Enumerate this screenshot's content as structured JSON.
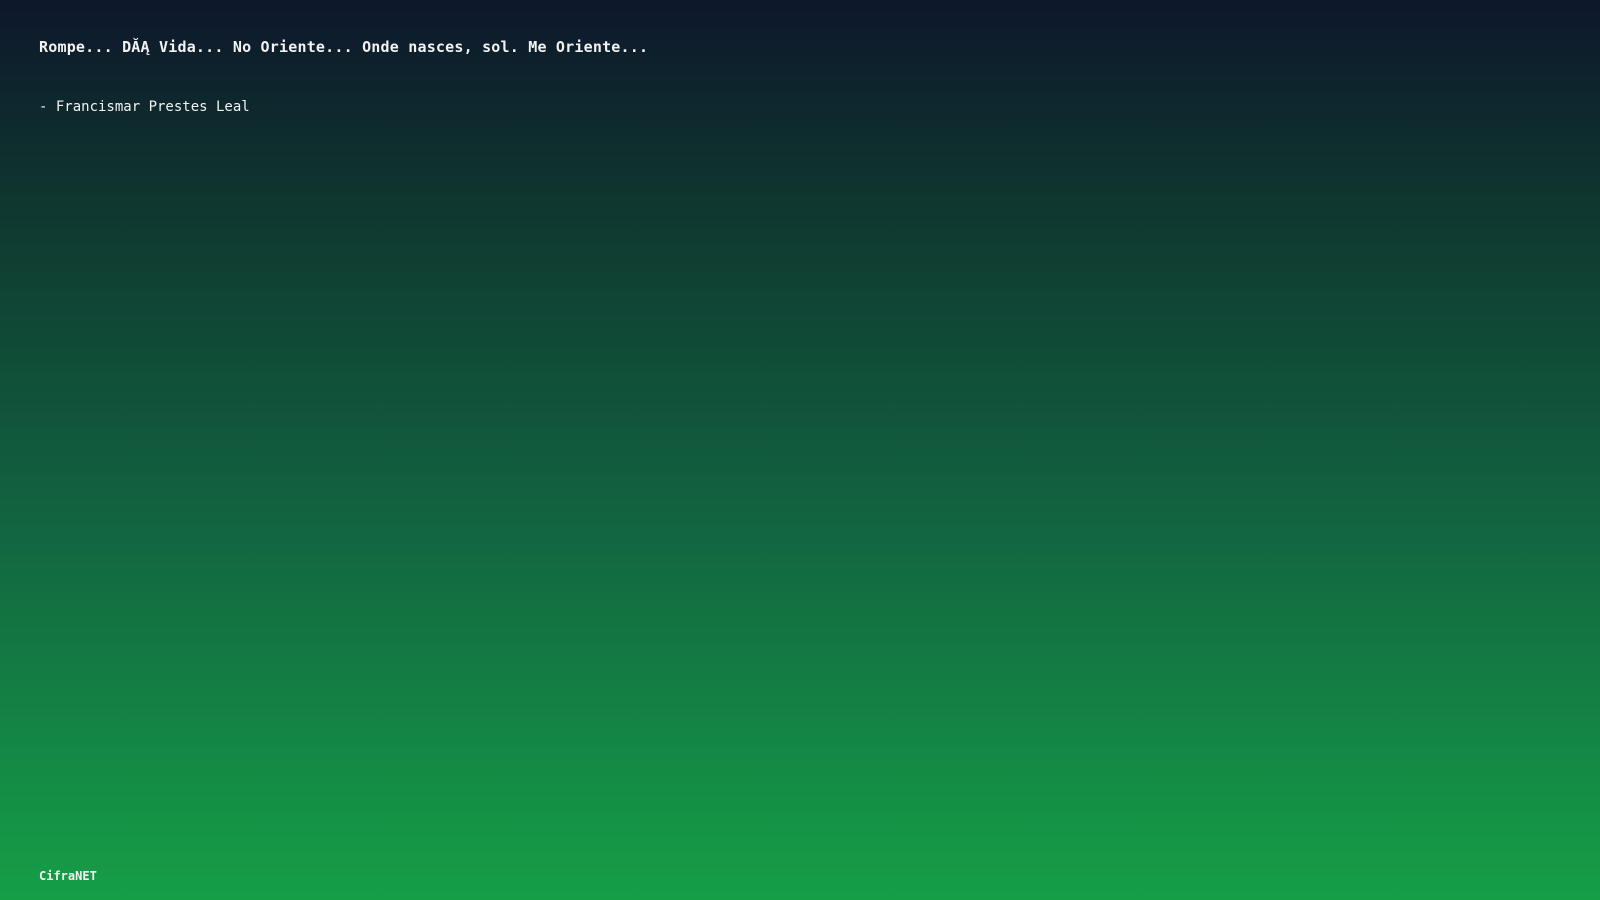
{
  "quote": {
    "text": "Rompe... DĂĄ Vida... No Oriente... Onde nasces, sol. Me Oriente...",
    "author": "- Francismar Prestes Leal"
  },
  "footer": {
    "brand": "CifraNET"
  },
  "colors": {
    "gradient_top": "#0e172b",
    "gradient_bottom": "#169e47",
    "text": "#f2f2f2"
  }
}
